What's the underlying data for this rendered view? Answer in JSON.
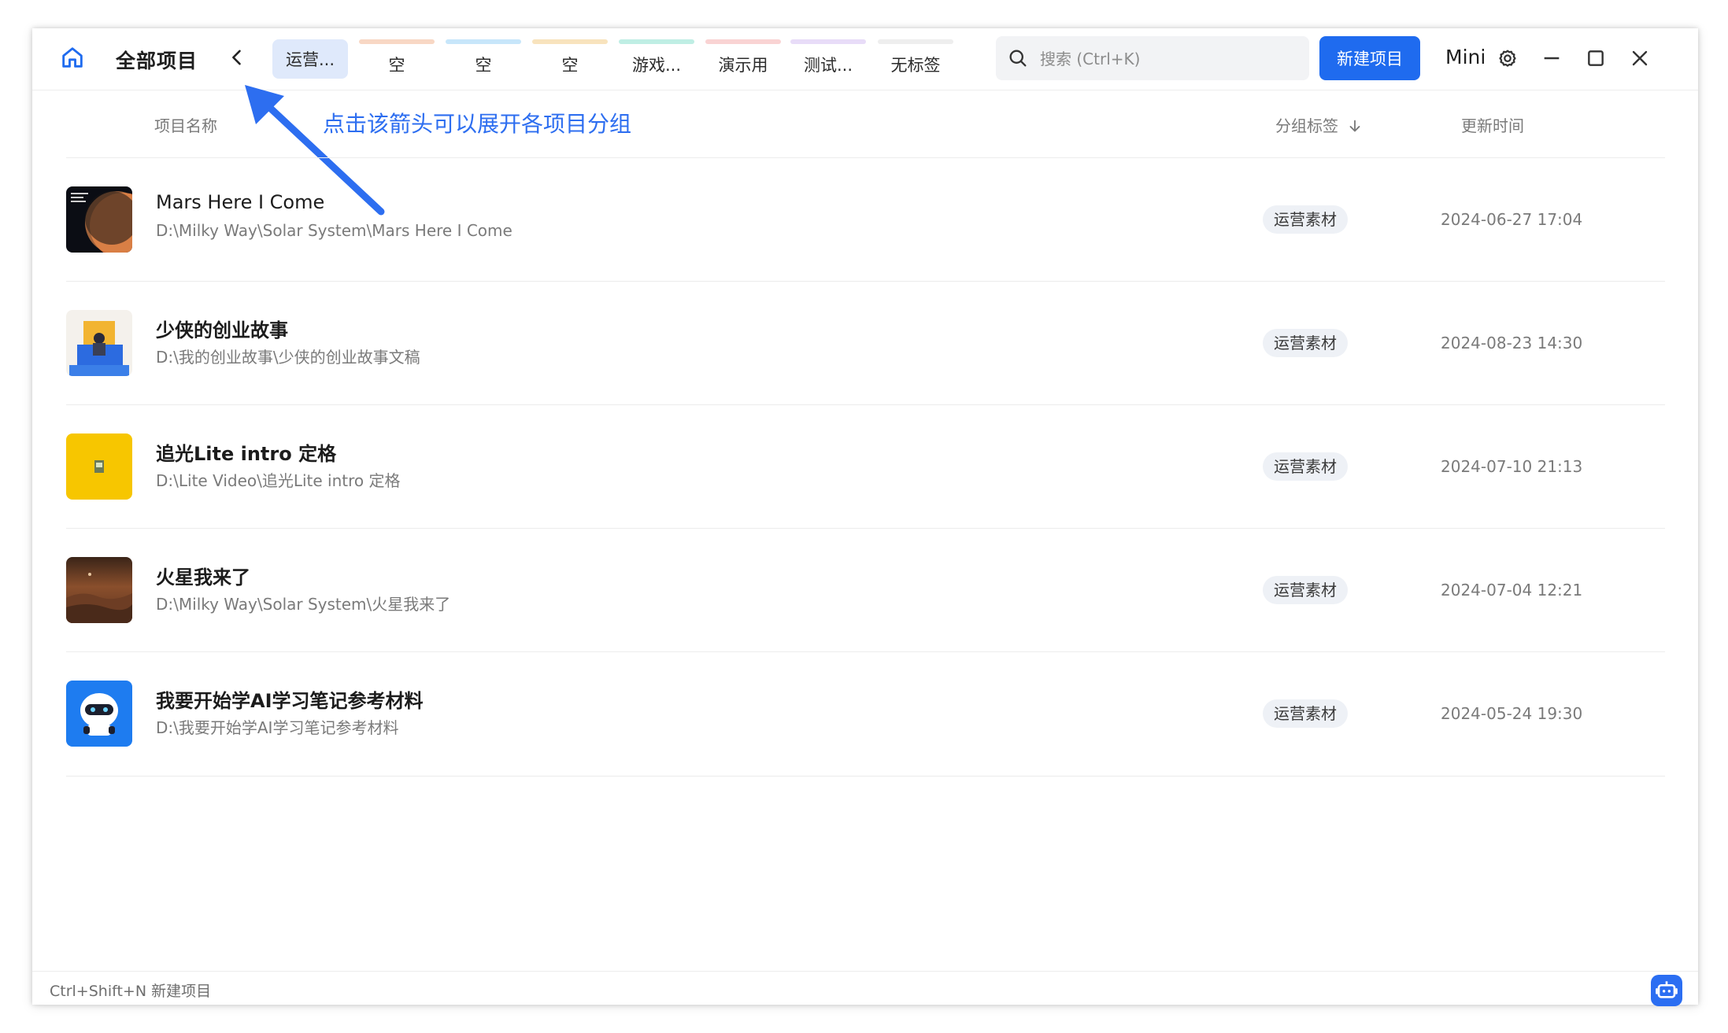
{
  "header": {
    "title": "全部项目",
    "tabs": [
      {
        "label": "运营...",
        "color": "#dfe9fb",
        "active": true
      },
      {
        "label": "空",
        "color": "#f8d7c4"
      },
      {
        "label": "空",
        "color": "#c7e6fa"
      },
      {
        "label": "空",
        "color": "#f8e3bd"
      },
      {
        "label": "游戏...",
        "color": "#bfeee4"
      },
      {
        "label": "演示用",
        "color": "#f9d3d3"
      },
      {
        "label": "测试...",
        "color": "#e8dcf8"
      },
      {
        "label": "无标签",
        "color": "#eeeeee"
      }
    ],
    "search_placeholder": "搜索 (Ctrl+K)",
    "new_project": "新建项目",
    "mini": "Mini"
  },
  "annotation": "点击该箭头可以展开各项目分组",
  "columns": {
    "name": "项目名称",
    "group_tag": "分组标签",
    "updated": "更新时间"
  },
  "projects": [
    {
      "title": "Mars Here I Come",
      "path": "D:\\Milky Way\\Solar System\\Mars Here I Come",
      "tag": "运营素材",
      "time": "2024-06-27 17:04"
    },
    {
      "title": "少侠的创业故事",
      "path": "D:\\我的创业故事\\少侠的创业故事文稿",
      "tag": "运营素材",
      "time": "2024-08-23 14:30"
    },
    {
      "title": "追光Lite intro 定格",
      "path": "D:\\Lite Video\\追光Lite intro 定格",
      "tag": "运营素材",
      "time": "2024-07-10 21:13"
    },
    {
      "title": "火星我来了",
      "path": "D:\\Milky Way\\Solar System\\火星我来了",
      "tag": "运营素材",
      "time": "2024-07-04 12:21"
    },
    {
      "title": "我要开始学AI学习笔记参考材料",
      "path": "D:\\我要开始学AI学习笔记参考材料",
      "tag": "运营素材",
      "time": "2024-05-24 19:30"
    }
  ],
  "footer": {
    "shortcut": "Ctrl+Shift+N 新建项目"
  },
  "accent_color": "#1f6bef"
}
